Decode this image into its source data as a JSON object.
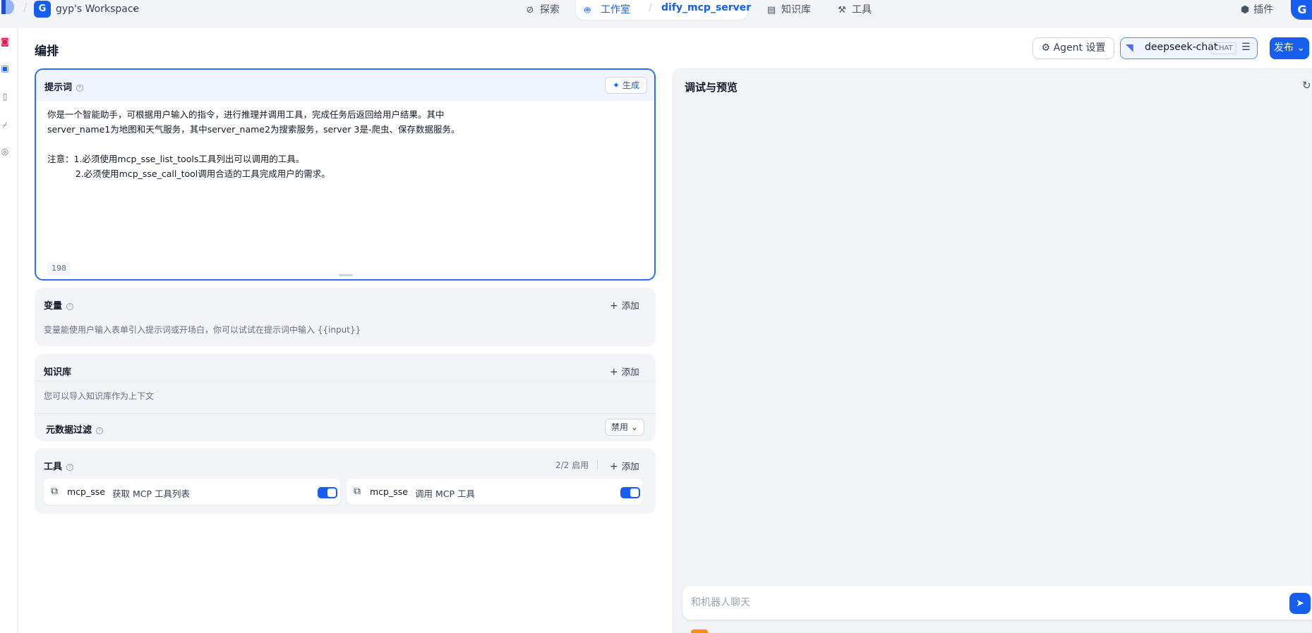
{
  "workspace": {
    "avatar": "G",
    "name": "gyp's Workspace"
  },
  "nav": {
    "explore": "探索",
    "studio": "工作室",
    "app_name": "dify_mcp_server",
    "knowledge": "知识库",
    "tools": "工具",
    "plugins": "插件"
  },
  "user": {
    "avatar": "G"
  },
  "page": {
    "title": "编排"
  },
  "toolbar": {
    "agent_settings": "Agent 设置",
    "model_name": "deepseek-chat",
    "model_tag": "CHAT",
    "publish": "发布"
  },
  "prompt": {
    "title": "提示词",
    "generate": "生成",
    "text": "你是一个智能助手，可根据用户输入的指令，进行推理并调用工具，完成任务后返回给用户结果。其中\nserver_name1为地图和天气服务，其中server_name2为搜索服务，server 3是-爬虫、保存数据服务。\n\n注意：1.必须使用mcp_sse_list_tools工具列出可以调用的工具。\n          2.必须使用mcp_sse_call_tool调用合适的工具完成用户的需求。",
    "char_count": "198"
  },
  "variables": {
    "title": "变量",
    "add": "添加",
    "desc": "变量能使用户输入表单引入提示词或开场白，你可以试试在提示词中输入 {{input}}"
  },
  "knowledge": {
    "title": "知识库",
    "add": "添加",
    "desc": "您可以导入知识库作为上下文",
    "metadata_filter": "元数据过滤",
    "metadata_value": "禁用"
  },
  "tools": {
    "title": "工具",
    "enabled": "2/2 启用",
    "add": "添加",
    "items": [
      {
        "provider": "mcp_sse",
        "name": "获取 MCP 工具列表",
        "enabled": true
      },
      {
        "provider": "mcp_sse",
        "name": "调用 MCP 工具",
        "enabled": true
      }
    ]
  },
  "preview": {
    "title": "调试与预览",
    "chat_placeholder": "和机器人聊天"
  },
  "colors": {
    "primary": "#155eef",
    "accent_border": "#2970ff",
    "whale": "#4d6bfe"
  }
}
